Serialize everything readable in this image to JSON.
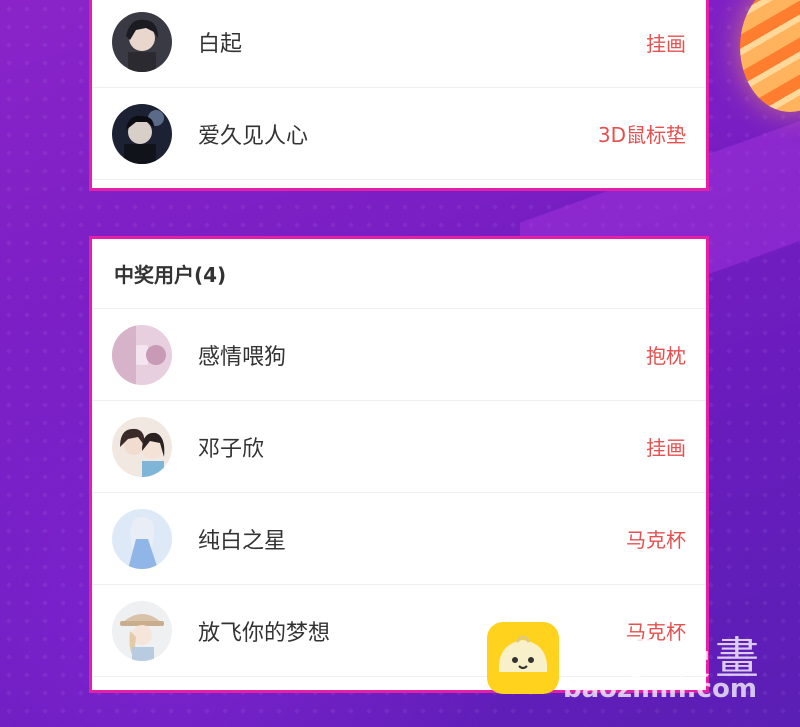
{
  "top_list": [
    {
      "name": "白起",
      "prize": "挂画",
      "avatar": "avatar-dark-hair"
    },
    {
      "name": "爱久见人心",
      "prize": "3D鼠标垫",
      "avatar": "avatar-dark-night"
    }
  ],
  "winners": {
    "header": "中奖用户(4)",
    "items": [
      {
        "name": "感情喂狗",
        "prize": "抱枕",
        "avatar": "avatar-pink"
      },
      {
        "name": "邓子欣",
        "prize": "挂画",
        "avatar": "avatar-couple"
      },
      {
        "name": "纯白之星",
        "prize": "马克杯",
        "avatar": "avatar-blue-dress"
      },
      {
        "name": "放飞你的梦想",
        "prize": "马克杯",
        "avatar": "avatar-hat-girl"
      }
    ]
  },
  "watermark": {
    "title": "包子漫畫",
    "url": "baozimh.com"
  },
  "colors": {
    "card_border": "#e61fa8",
    "prize_text": "#e6504f",
    "background": "#7a1fc4"
  }
}
